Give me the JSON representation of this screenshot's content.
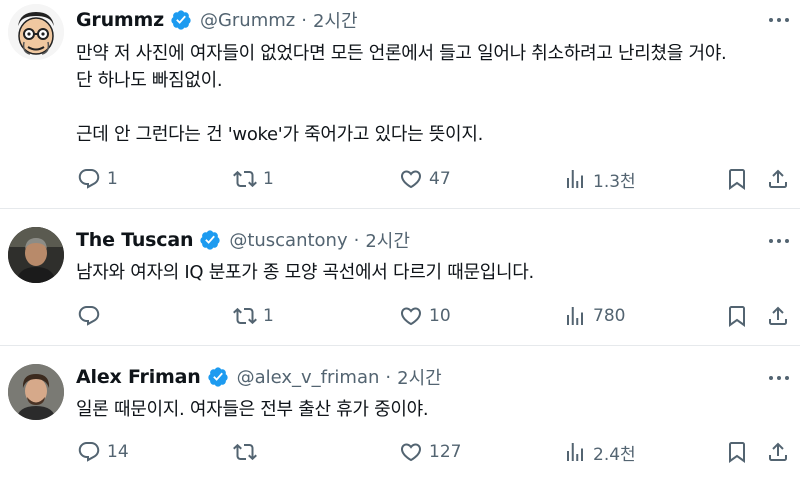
{
  "tweets": [
    {
      "name": "Grummz",
      "handle": "@Grummz",
      "time": "2시간",
      "text": "만약 저 사진에 여자들이 없었다면 모든 언론에서 들고 일어나 취소하려고 난리쳤을 거야.\n단 하나도 빠짐없이.\n\n근데 안 그런다는 건 'woke'가 죽어가고 있다는 뜻이지.",
      "stats": {
        "replies": "1",
        "retweets": "1",
        "likes": "47",
        "views": "1.3천"
      }
    },
    {
      "name": "The Tuscan",
      "handle": "@tuscantony",
      "time": "2시간",
      "text": "남자와 여자의 IQ 분포가 종 모양 곡선에서 다르기 때문입니다.",
      "stats": {
        "replies": "",
        "retweets": "1",
        "likes": "10",
        "views": "780"
      }
    },
    {
      "name": "Alex Friman",
      "handle": "@alex_v_friman",
      "time": "2시간",
      "text": "일론 때문이지. 여자들은 전부 출산 휴가 중이야.",
      "stats": {
        "replies": "14",
        "retweets": "",
        "likes": "127",
        "views": "2.4천"
      }
    }
  ],
  "separator": "·",
  "colors": {
    "text": "#0f1419",
    "muted": "#536471",
    "verified": "#1d9bf0",
    "divider": "#e6e9ec"
  },
  "icons": [
    "verified-badge-icon",
    "more-icon",
    "reply-icon",
    "retweet-icon",
    "like-icon",
    "views-icon",
    "bookmark-icon",
    "share-icon"
  ]
}
